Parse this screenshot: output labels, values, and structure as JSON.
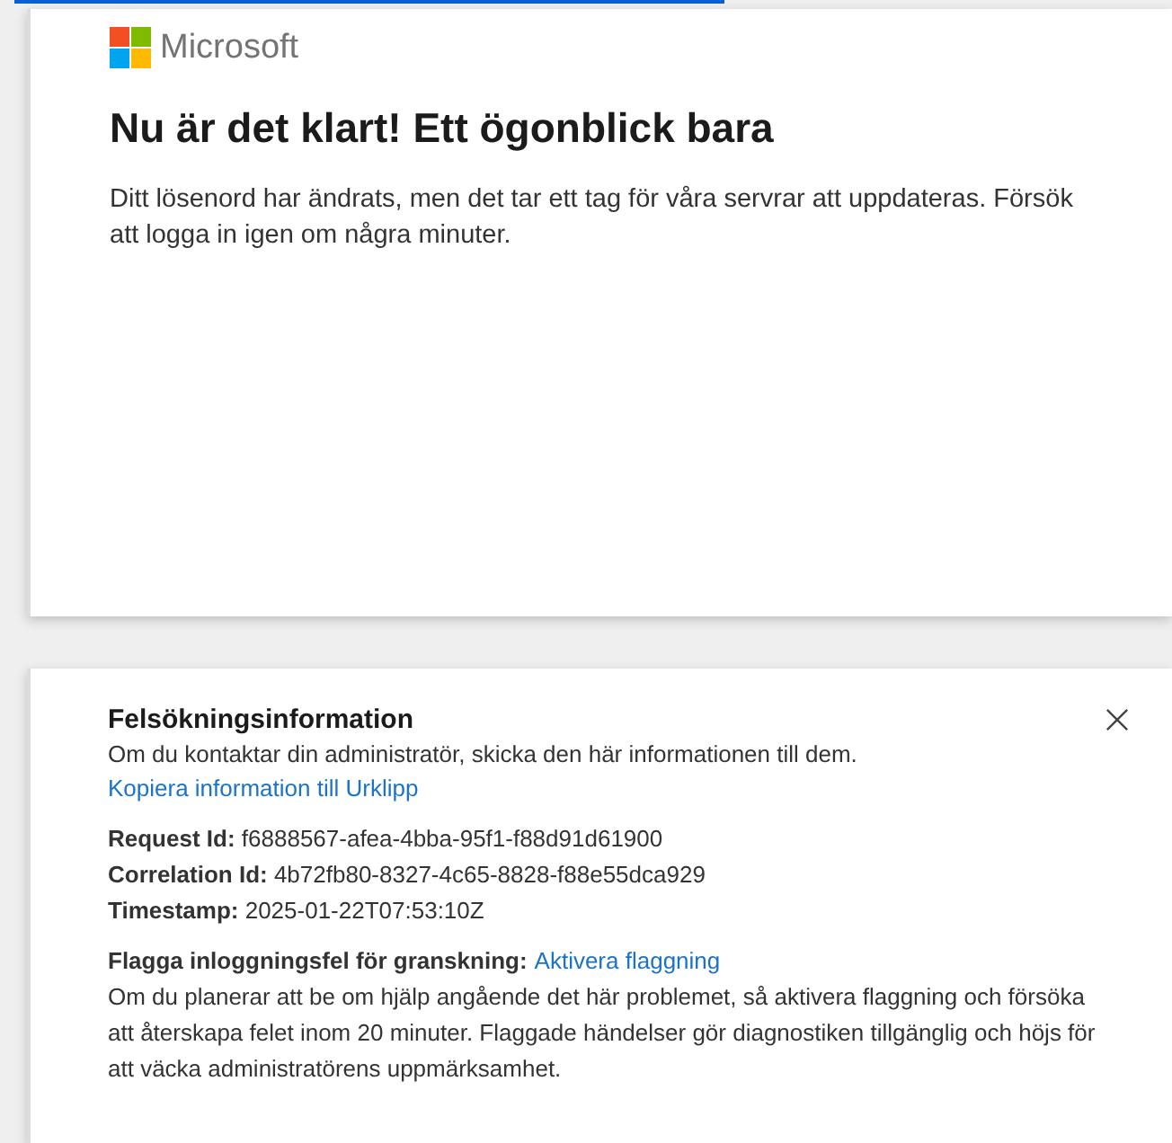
{
  "brand": {
    "name": "Microsoft"
  },
  "message": {
    "title": "Nu är det klart! Ett ögonblick bara",
    "body": "Ditt lösenord har ändrats, men det tar ett tag för våra servrar att uppdateras. Försök att logga in igen om några minuter."
  },
  "debug_panel": {
    "title": "Felsökningsinformation",
    "description": "Om du kontaktar din administratör, skicka den här informationen till dem.",
    "copy_link": "Kopiera information till Urklipp",
    "details": [
      {
        "text": "**Request Id:** f6888567-afea-4bba-95f1-f88d91d61900"
      },
      {
        "text": "**Correlation Id:** 4b72fb80-8327-4c65-8828-f88e55dca929"
      },
      {
        "text": "**Timestamp:** 2025-01-22T07:53:10Z"
      }
    ],
    "flagging": {
      "label": "Flagga inloggningsfel för granskning:",
      "link": "Aktivera flaggning",
      "description": "Om du planerar att be om hjälp angående det här problemet, så aktivera flaggning och försöka att återskapa felet inom 20 minuter. Flaggade händelser gör diagnostiken tillgänglig och höjs för att väcka administratörens uppmärksamhet."
    }
  }
}
